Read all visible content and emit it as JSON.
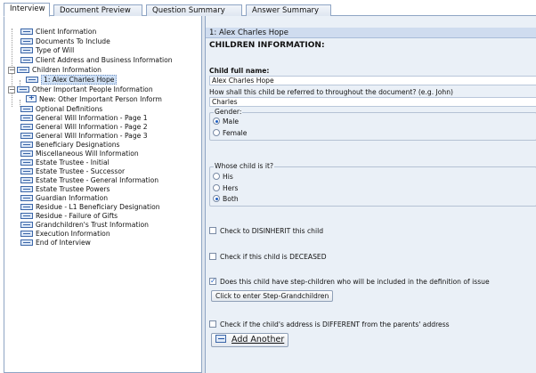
{
  "tabs": [
    {
      "label": "Interview",
      "active": true
    },
    {
      "label": "Document Preview",
      "active": false
    },
    {
      "label": "Question Summary",
      "active": false
    },
    {
      "label": "Answer Summary",
      "active": false
    }
  ],
  "tree": {
    "items": [
      {
        "label": "Client Information"
      },
      {
        "label": "Documents To Include"
      },
      {
        "label": "Type of Will"
      },
      {
        "label": "Client Address and Business Information"
      },
      {
        "label": "Children Information",
        "expander": "−"
      },
      {
        "label": "1: Alex Charles Hope",
        "selected": true
      },
      {
        "label": "Other Important People Information",
        "expander": "−"
      },
      {
        "label": "New: Other Important Person Inform"
      },
      {
        "label": "Optional Definitions"
      },
      {
        "label": "General Will Information - Page 1"
      },
      {
        "label": "General Will Information - Page 2"
      },
      {
        "label": "General Will Information - Page 3"
      },
      {
        "label": "Beneficiary Designations"
      },
      {
        "label": "Miscellaneous Will Information"
      },
      {
        "label": "Estate Trustee - Initial"
      },
      {
        "label": "Estate Trustee - Successor"
      },
      {
        "label": "Estate Trustee - General Information"
      },
      {
        "label": "Estate Trustee Powers"
      },
      {
        "label": "Guardian Information"
      },
      {
        "label": "Residue - L1 Beneficiary Designation"
      },
      {
        "label": "Residue - Failure of Gifts"
      },
      {
        "label": "Grandchildren's Trust Information"
      },
      {
        "label": "Execution Information"
      },
      {
        "label": "End of Interview"
      }
    ]
  },
  "main": {
    "header": "1: Alex Charles Hope",
    "section_title": "CHILDREN INFORMATION:",
    "child_name_label": "Child full name:",
    "child_name_value": "Alex Charles Hope",
    "referred_label": "How shall this child be referred to throughout the document? (e.g. John)",
    "referred_value": "Charles",
    "gender": {
      "legend": "Gender:",
      "options": [
        {
          "label": "Male",
          "selected": true
        },
        {
          "label": "Female",
          "selected": false
        }
      ]
    },
    "whose": {
      "legend": "Whose child is it?",
      "options": [
        {
          "label": "His",
          "selected": false
        },
        {
          "label": "Hers",
          "selected": false
        },
        {
          "label": "Both",
          "selected": true
        }
      ]
    },
    "disinherit_label": "Check to DISINHERIT this child",
    "deceased_label": "Check if this child is DECEASED",
    "step_children_label": "Does this child have step-children who will be included in the definition of issue",
    "step_grandchildren_button": "Click to enter Step-Grandchildren",
    "address_label": "Check if the child's address is DIFFERENT from the parents' address",
    "add_another_label": "Add Another"
  }
}
